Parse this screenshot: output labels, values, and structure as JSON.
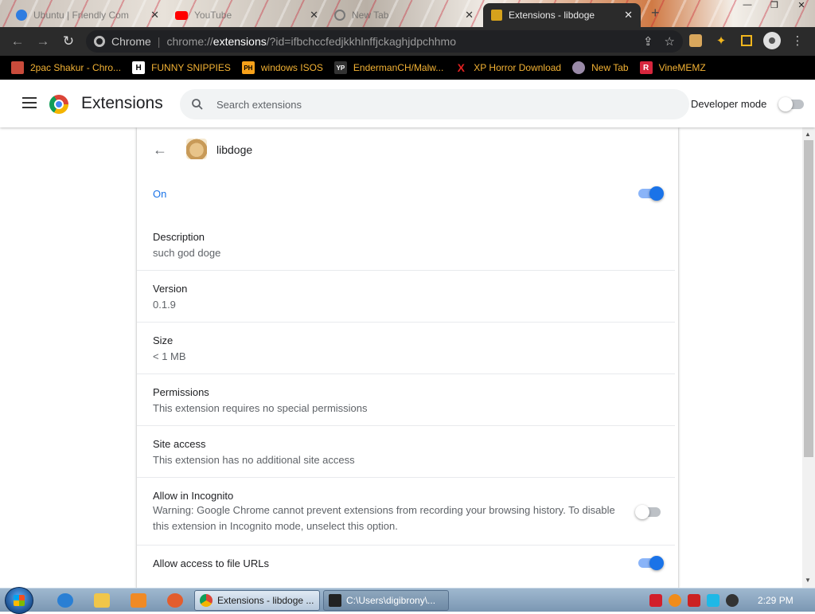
{
  "browser": {
    "tabs": [
      {
        "title": "Ubuntu | Friendly Com...",
        "active": false
      },
      {
        "title": "YouTube",
        "active": false
      },
      {
        "title": "New Tab",
        "active": false
      },
      {
        "title": "Extensions - libdoge",
        "active": true
      }
    ],
    "omnibox": {
      "chip": "Chrome",
      "url_scheme": "chrome://",
      "url_host": "extensions",
      "url_path": "/?id=ifbchccfedjkkhlnffjckaghjdpchhmo"
    },
    "bookmarks": [
      {
        "label": "2pac Shakur - Chro...",
        "icon": "bookmark-icon"
      },
      {
        "label": "FUNNY SNIPPIES",
        "icon": "H"
      },
      {
        "label": "windows ISOS",
        "icon": "PH"
      },
      {
        "label": "EndermanCH/Malw...",
        "icon": "YP"
      },
      {
        "label": "XP Horror Download",
        "icon": "X"
      },
      {
        "label": "New Tab",
        "icon": "globe-icon"
      },
      {
        "label": "VineMEMZ",
        "icon": "R"
      }
    ]
  },
  "header": {
    "title": "Extensions",
    "search_placeholder": "Search extensions",
    "dev_mode_label": "Developer mode",
    "dev_mode_on": false
  },
  "detail": {
    "name": "libdoge",
    "on_label": "On",
    "enabled": true,
    "description_label": "Description",
    "description": "such god doge",
    "version_label": "Version",
    "version": "0.1.9",
    "size_label": "Size",
    "size": "< 1 MB",
    "permissions_label": "Permissions",
    "permissions": "This extension requires no special permissions",
    "site_access_label": "Site access",
    "site_access": "This extension has no additional site access",
    "incognito_label": "Allow in Incognito",
    "incognito_warning_line1": "Warning: Google Chrome cannot prevent extensions from recording your browsing history. To disable",
    "incognito_warning_line2": "this extension in Incognito mode, unselect this option.",
    "incognito_on": false,
    "file_urls_label": "Allow access to file URLs",
    "file_urls_on": true
  },
  "taskbar": {
    "tasks": [
      {
        "label": "Extensions - libdoge ..."
      },
      {
        "label": "C:\\Users\\digibrony\\..."
      }
    ],
    "clock": "2:29 PM"
  },
  "colors": {
    "accent": "#1a73e8",
    "toolbar_bg": "#2b2b2b",
    "bookmark_text": "#f3b234"
  }
}
